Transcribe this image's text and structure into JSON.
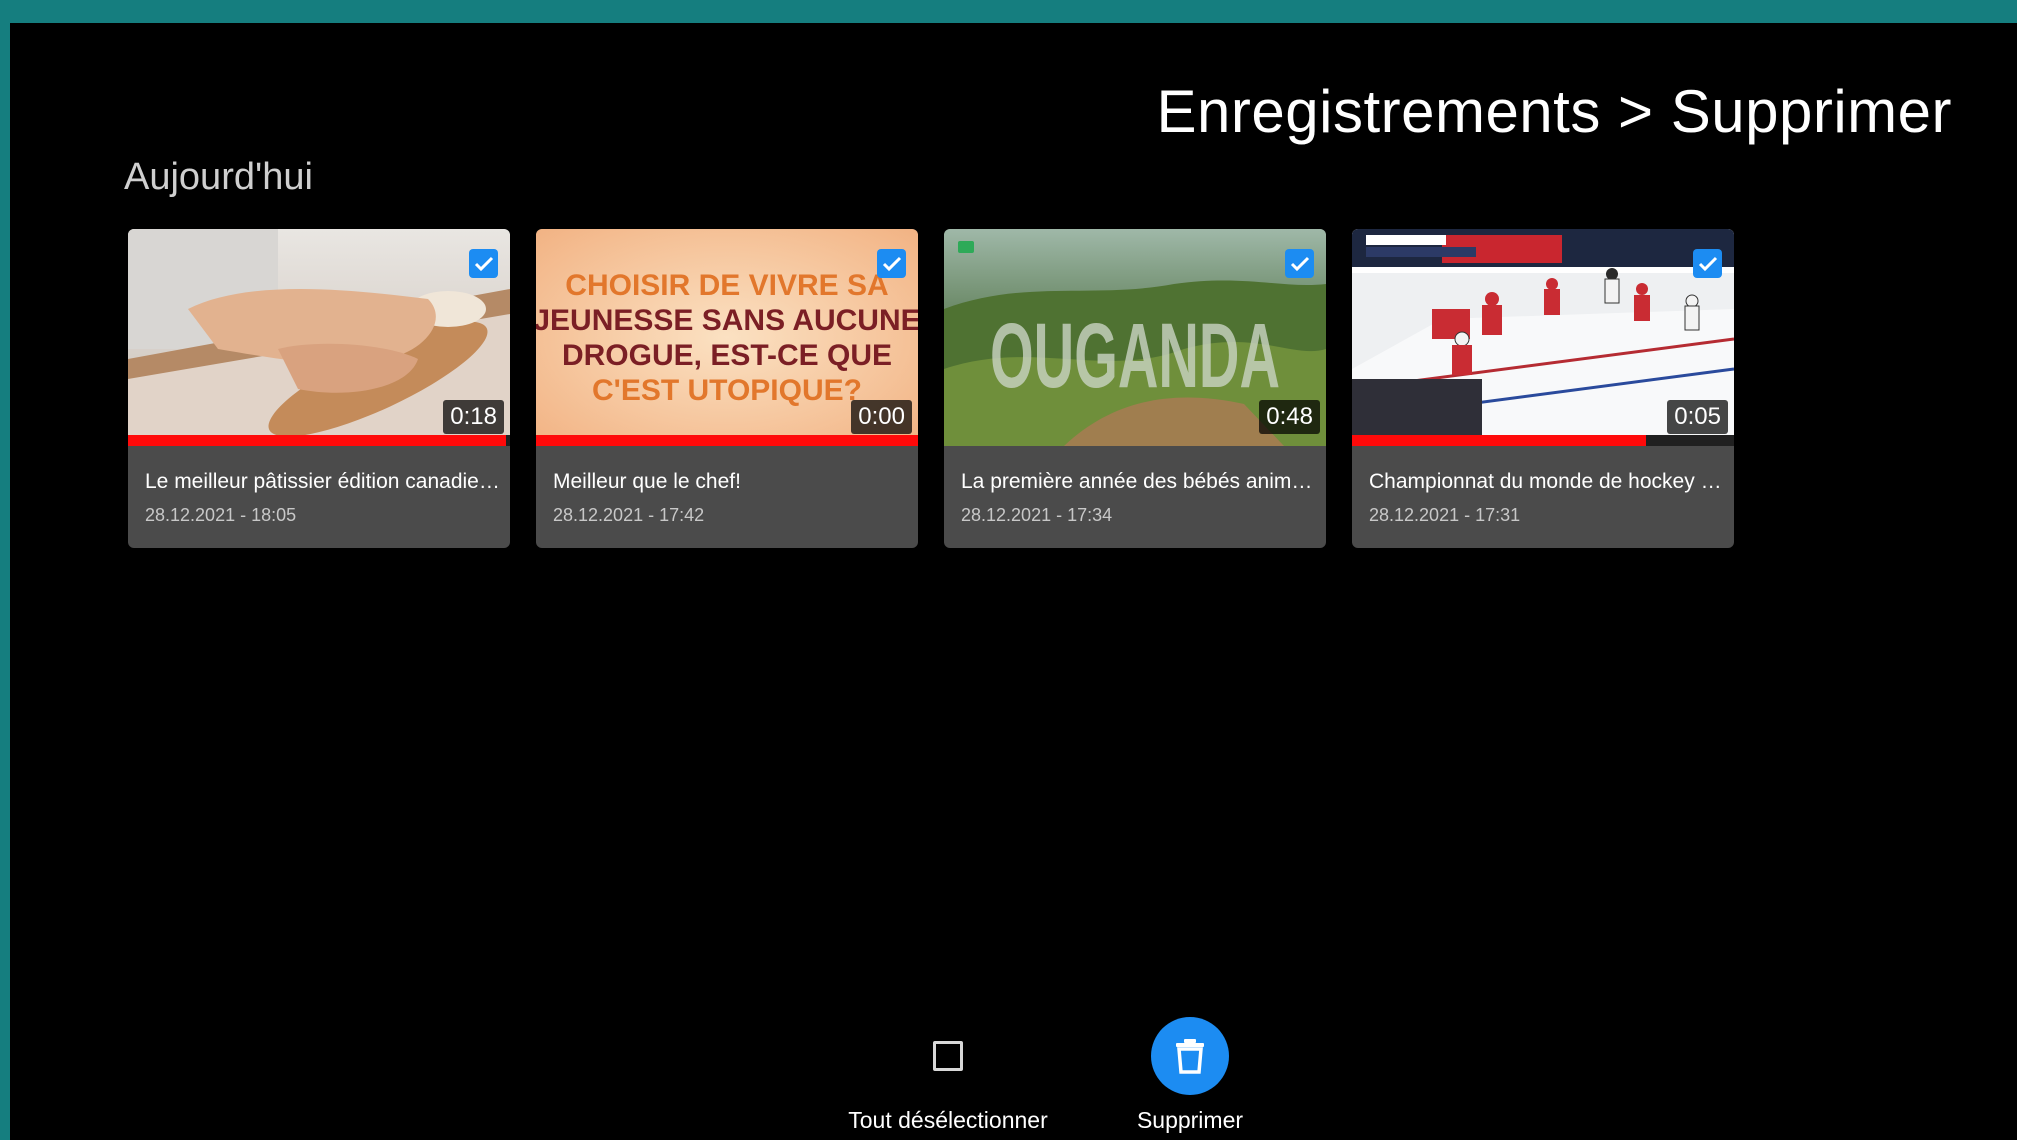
{
  "header": {
    "title": "Enregistrements > Supprimer"
  },
  "section": {
    "title": "Aujourd'hui"
  },
  "recordings": [
    {
      "title": "Le meilleur pâtissier édition canadien...",
      "date": "28.12.2021 - 18:05",
      "duration": "0:18",
      "progress": 0.99,
      "selected": true,
      "thumbnail": "pastry-dough-icon"
    },
    {
      "title": "Meilleur que le chef!",
      "date": "28.12.2021 - 17:42",
      "duration": "0:00",
      "progress": 1.0,
      "selected": true,
      "thumbnail": "title-card-icon",
      "thumbnail_text": [
        "CHOISIR DE VIVRE SA",
        "JEUNESSE SANS AUCUNE",
        "DROGUE, EST-CE QUE",
        "C'EST UTOPIQUE?"
      ]
    },
    {
      "title": "La première année des bébés animaux",
      "date": "28.12.2021 - 17:34",
      "duration": "0:48",
      "progress": 0.0,
      "selected": true,
      "thumbnail": "landscape-icon",
      "thumbnail_text": "OUGANDA"
    },
    {
      "title": "Championnat du monde de hockey ju...",
      "date": "28.12.2021 - 17:31",
      "duration": "0:05",
      "progress": 0.77,
      "selected": true,
      "thumbnail": "hockey-rink-icon"
    }
  ],
  "actions": {
    "deselect_label": "Tout désélectionner",
    "delete_label": "Supprimer"
  },
  "colors": {
    "frame": "#157e7f",
    "accent": "#1c8cf2",
    "progress": "#ff0a0a",
    "card": "#4b4b4b"
  }
}
